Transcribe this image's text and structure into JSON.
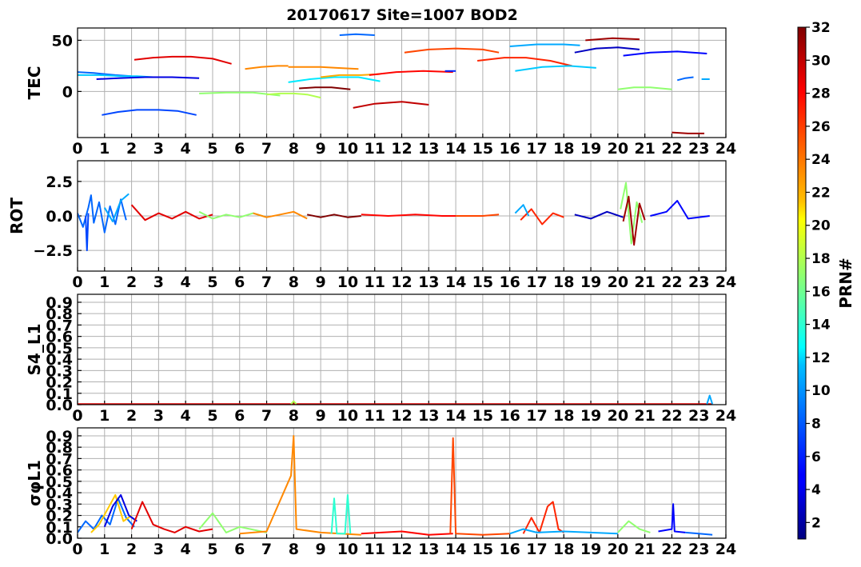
{
  "figure": {
    "title": "20170617 Site=1007 BOD2",
    "x_ticks": [
      "0",
      "1",
      "2",
      "3",
      "4",
      "5",
      "6",
      "7",
      "8",
      "9",
      "10",
      "11",
      "12",
      "13",
      "14",
      "15",
      "16",
      "17",
      "18",
      "19",
      "20",
      "21",
      "22",
      "23",
      "24"
    ]
  },
  "colorbar": {
    "label": "PRN#",
    "range": [
      1,
      32
    ],
    "ticks": [
      "2",
      "4",
      "6",
      "8",
      "10",
      "12",
      "14",
      "16",
      "18",
      "20",
      "22",
      "24",
      "26",
      "28",
      "30",
      "32"
    ],
    "colormap": "jet"
  },
  "chart_data": [
    {
      "type": "line",
      "ylabel": "TEC",
      "xlim": [
        0,
        24
      ],
      "ylim": [
        -45,
        62
      ],
      "y_ticks": [
        "0",
        "50"
      ],
      "grid": true,
      "series": [
        {
          "prn": 8,
          "x": [
            0,
            0.6,
            1.0,
            1.4,
            2.0
          ],
          "y": [
            19,
            18,
            17,
            16,
            15
          ]
        },
        {
          "prn": 11,
          "x": [
            0,
            0.8,
            1.6,
            2.2,
            2.8
          ],
          "y": [
            16,
            16,
            15,
            15,
            14
          ]
        },
        {
          "prn": 4,
          "x": [
            0.7,
            1.5,
            2.5,
            3.5,
            4.5
          ],
          "y": [
            12,
            13,
            14,
            14,
            13
          ]
        },
        {
          "prn": 7,
          "x": [
            0.9,
            1.5,
            2.2,
            3.0,
            3.7,
            4.4
          ],
          "y": [
            -23,
            -20,
            -18,
            -18,
            -19,
            -23
          ]
        },
        {
          "prn": 29,
          "x": [
            2.1,
            2.8,
            3.5,
            4.2,
            5.0,
            5.7
          ],
          "y": [
            31,
            33,
            34,
            34,
            32,
            27
          ]
        },
        {
          "prn": 17,
          "x": [
            4.5,
            5.5,
            6.5,
            7.5
          ],
          "y": [
            -2,
            -1,
            -1,
            -4
          ]
        },
        {
          "prn": 24,
          "x": [
            6.2,
            6.8,
            7.4,
            7.8
          ],
          "y": [
            22,
            24,
            25,
            25
          ]
        },
        {
          "prn": 18,
          "x": [
            7.0,
            7.5,
            8.0,
            8.5,
            9.0
          ],
          "y": [
            -3,
            -2,
            -2,
            -3,
            -6
          ]
        },
        {
          "prn": 24,
          "x": [
            7.8,
            8.4,
            9.0,
            9.6,
            10.4
          ],
          "y": [
            24,
            24,
            24,
            23,
            22
          ]
        },
        {
          "prn": 12,
          "x": [
            7.8,
            8.6,
            9.5,
            10.4,
            11.2
          ],
          "y": [
            9,
            12,
            14,
            14,
            10
          ]
        },
        {
          "prn": 32,
          "x": [
            8.2,
            8.8,
            9.4,
            10.1
          ],
          "y": [
            3,
            4,
            4,
            2
          ]
        },
        {
          "prn": 23,
          "x": [
            9.0,
            9.7,
            10.5,
            11.2
          ],
          "y": [
            14,
            16,
            16,
            17
          ]
        },
        {
          "prn": 8,
          "x": [
            9.7,
            10.3,
            11.0
          ],
          "y": [
            55,
            56,
            55
          ]
        },
        {
          "prn": 30,
          "x": [
            10.2,
            11.0,
            12.0,
            13.0
          ],
          "y": [
            -16,
            -12,
            -10,
            -13
          ]
        },
        {
          "prn": 28,
          "x": [
            10.8,
            11.8,
            12.8,
            13.9
          ],
          "y": [
            16,
            19,
            20,
            19
          ]
        },
        {
          "prn": 6,
          "x": [
            13.6,
            14.0
          ],
          "y": [
            20,
            20
          ]
        },
        {
          "prn": 26,
          "x": [
            12.1,
            13.0,
            14.0,
            15.0,
            15.6
          ],
          "y": [
            38,
            41,
            42,
            41,
            38
          ]
        },
        {
          "prn": 27,
          "x": [
            14.8,
            15.8,
            16.6,
            17.5,
            18.3
          ],
          "y": [
            30,
            33,
            33,
            30,
            25
          ]
        },
        {
          "prn": 10,
          "x": [
            16.0,
            17.0,
            18.0,
            18.6
          ],
          "y": [
            44,
            46,
            46,
            45
          ]
        },
        {
          "prn": 11,
          "x": [
            16.2,
            17.2,
            18.2,
            19.2
          ],
          "y": [
            20,
            24,
            25,
            23
          ]
        },
        {
          "prn": 3,
          "x": [
            18.4,
            19.2,
            20.0,
            20.8
          ],
          "y": [
            38,
            42,
            43,
            41
          ]
        },
        {
          "prn": 31,
          "x": [
            18.8,
            19.8,
            20.8
          ],
          "y": [
            50,
            52,
            51
          ]
        },
        {
          "prn": 5,
          "x": [
            20.2,
            21.2,
            22.2,
            23.3
          ],
          "y": [
            35,
            38,
            39,
            37
          ]
        },
        {
          "prn": 17,
          "x": [
            20.0,
            20.6,
            21.2,
            22.0
          ],
          "y": [
            2,
            4,
            4,
            2
          ]
        },
        {
          "prn": 8,
          "x": [
            22.2,
            22.5,
            22.8
          ],
          "y": [
            11,
            13,
            14
          ]
        },
        {
          "prn": 10,
          "x": [
            23.1,
            23.4
          ],
          "y": [
            12,
            12
          ]
        },
        {
          "prn": 31,
          "x": [
            22.0,
            22.6,
            23.2
          ],
          "y": [
            -40,
            -41,
            -41
          ]
        }
      ]
    },
    {
      "type": "line",
      "ylabel": "ROT",
      "xlim": [
        0,
        24
      ],
      "ylim": [
        -4,
        4
      ],
      "y_ticks": [
        "-2.5",
        "0.0",
        "2.5"
      ],
      "grid": true,
      "series": [
        {
          "prn": 8,
          "x": [
            0.0,
            0.2,
            0.4,
            0.5,
            0.6,
            0.8,
            1.0,
            1.2,
            1.4,
            1.6,
            1.8
          ],
          "y": [
            0.2,
            -0.8,
            0.6,
            1.5,
            -0.5,
            1.0,
            -1.2,
            0.7,
            -0.6,
            1.2,
            -0.3
          ]
        },
        {
          "prn": 7,
          "x": [
            0.3,
            0.35,
            0.4
          ],
          "y": [
            0.0,
            -2.5,
            0.2
          ]
        },
        {
          "prn": 10,
          "x": [
            1.0,
            1.3,
            1.6,
            1.9
          ],
          "y": [
            0.6,
            -0.4,
            1.1,
            1.6
          ]
        },
        {
          "prn": 29,
          "x": [
            2.0,
            2.5,
            3.0,
            3.5,
            4.0,
            4.5,
            5.0
          ],
          "y": [
            0.8,
            -0.3,
            0.2,
            -0.2,
            0.3,
            -0.2,
            0.1
          ]
        },
        {
          "prn": 17,
          "x": [
            4.5,
            5.0,
            5.5,
            6.0,
            6.5,
            7.0
          ],
          "y": [
            0.3,
            -0.2,
            0.1,
            -0.1,
            0.2,
            -0.1
          ]
        },
        {
          "prn": 24,
          "x": [
            6.5,
            7.0,
            7.5,
            8.0,
            8.5
          ],
          "y": [
            0.2,
            -0.1,
            0.1,
            0.3,
            -0.2
          ]
        },
        {
          "prn": 32,
          "x": [
            8.5,
            9.0,
            9.5,
            10.0,
            10.5
          ],
          "y": [
            0.1,
            -0.1,
            0.1,
            -0.1,
            0.0
          ]
        },
        {
          "prn": 28,
          "x": [
            10.5,
            11.5,
            12.5,
            13.5,
            14.0
          ],
          "y": [
            0.1,
            0.0,
            0.1,
            0.0,
            0.0
          ]
        },
        {
          "prn": 26,
          "x": [
            14.0,
            15.0,
            15.6
          ],
          "y": [
            0.0,
            0.0,
            0.1
          ]
        },
        {
          "prn": 27,
          "x": [
            16.4,
            16.8,
            17.2,
            17.6,
            18.0
          ],
          "y": [
            -0.3,
            0.5,
            -0.6,
            0.2,
            -0.1
          ]
        },
        {
          "prn": 10,
          "x": [
            16.2,
            16.5,
            16.7
          ],
          "y": [
            0.2,
            0.8,
            0.0
          ]
        },
        {
          "prn": 3,
          "x": [
            18.4,
            19.0,
            19.6,
            20.2
          ],
          "y": [
            0.1,
            -0.2,
            0.3,
            -0.1
          ]
        },
        {
          "prn": 17,
          "x": [
            20.1,
            20.3,
            20.5,
            20.7,
            20.9
          ],
          "y": [
            0.5,
            2.4,
            -2.0,
            1.0,
            -0.5
          ]
        },
        {
          "prn": 31,
          "x": [
            20.2,
            20.4,
            20.6,
            20.8,
            21.0
          ],
          "y": [
            -0.4,
            1.4,
            -2.1,
            0.9,
            -0.3
          ]
        },
        {
          "prn": 5,
          "x": [
            21.2,
            21.8,
            22.2,
            22.6,
            23.4
          ],
          "y": [
            0.0,
            0.3,
            1.1,
            -0.2,
            0.0
          ]
        }
      ]
    },
    {
      "type": "line",
      "ylabel": "S4_L1",
      "xlim": [
        0,
        24
      ],
      "ylim": [
        0,
        0.97
      ],
      "y_ticks": [
        "0.0",
        "0.1",
        "0.2",
        "0.3",
        "0.4",
        "0.5",
        "0.6",
        "0.7",
        "0.8",
        "0.9"
      ],
      "grid": true,
      "series": [
        {
          "prn": 29,
          "x": [
            0,
            6,
            12,
            18,
            23.5
          ],
          "y": [
            0.005,
            0.005,
            0.005,
            0.005,
            0.005
          ]
        },
        {
          "prn": 18,
          "x": [
            7.9,
            8.0,
            8.1
          ],
          "y": [
            0.005,
            0.03,
            0.005
          ]
        },
        {
          "prn": 10,
          "x": [
            23.3,
            23.4,
            23.5
          ],
          "y": [
            0.005,
            0.08,
            0.005
          ]
        }
      ]
    },
    {
      "type": "line",
      "ylabel": "σφL1",
      "xlim": [
        0,
        24
      ],
      "ylim": [
        0,
        0.97
      ],
      "y_ticks": [
        "0.0",
        "0.1",
        "0.2",
        "0.3",
        "0.4",
        "0.5",
        "0.6",
        "0.7",
        "0.8",
        "0.9"
      ],
      "grid": true,
      "series": [
        {
          "prn": 8,
          "x": [
            0.0,
            0.3,
            0.6,
            0.9,
            1.2,
            1.5,
            1.8,
            2.1
          ],
          "y": [
            0.05,
            0.15,
            0.08,
            0.2,
            0.12,
            0.35,
            0.18,
            0.1
          ]
        },
        {
          "prn": 22,
          "x": [
            0.5,
            0.8,
            1.1,
            1.4,
            1.7,
            2.0
          ],
          "y": [
            0.05,
            0.12,
            0.25,
            0.38,
            0.15,
            0.2
          ]
        },
        {
          "prn": 4,
          "x": [
            1.0,
            1.3,
            1.6,
            1.9,
            2.2
          ],
          "y": [
            0.1,
            0.28,
            0.38,
            0.2,
            0.15
          ]
        },
        {
          "prn": 29,
          "x": [
            2.0,
            2.4,
            2.8,
            3.2,
            3.6,
            4.0,
            4.5,
            5.0
          ],
          "y": [
            0.08,
            0.32,
            0.12,
            0.08,
            0.05,
            0.1,
            0.06,
            0.08
          ]
        },
        {
          "prn": 17,
          "x": [
            4.5,
            5.0,
            5.5,
            6.0,
            7.0
          ],
          "y": [
            0.08,
            0.22,
            0.05,
            0.1,
            0.05
          ]
        },
        {
          "prn": 24,
          "x": [
            6.0,
            7.0,
            7.9,
            8.0,
            8.1,
            9.0,
            10.5
          ],
          "y": [
            0.04,
            0.06,
            0.55,
            0.9,
            0.08,
            0.05,
            0.03
          ]
        },
        {
          "prn": 14,
          "x": [
            9.4,
            9.5,
            9.6,
            9.9,
            10.0,
            10.1
          ],
          "y": [
            0.04,
            0.35,
            0.04,
            0.04,
            0.38,
            0.04
          ]
        },
        {
          "prn": 28,
          "x": [
            10.5,
            12.0,
            13.0,
            13.9
          ],
          "y": [
            0.04,
            0.06,
            0.03,
            0.04
          ]
        },
        {
          "prn": 26,
          "x": [
            13.8,
            13.9,
            14.0,
            15.0,
            16.0
          ],
          "y": [
            0.04,
            0.88,
            0.04,
            0.03,
            0.04
          ]
        },
        {
          "prn": 27,
          "x": [
            16.5,
            16.8,
            17.1,
            17.4,
            17.6,
            17.8,
            18.0
          ],
          "y": [
            0.04,
            0.18,
            0.05,
            0.28,
            0.32,
            0.08,
            0.05
          ]
        },
        {
          "prn": 10,
          "x": [
            16.0,
            16.5,
            17.0,
            18.0,
            19.0,
            20.0
          ],
          "y": [
            0.04,
            0.08,
            0.05,
            0.06,
            0.05,
            0.04
          ]
        },
        {
          "prn": 17,
          "x": [
            20.0,
            20.4,
            20.8,
            21.2
          ],
          "y": [
            0.05,
            0.15,
            0.08,
            0.05
          ]
        },
        {
          "prn": 5,
          "x": [
            21.5,
            22.0,
            22.05,
            22.1,
            22.5
          ],
          "y": [
            0.06,
            0.08,
            0.3,
            0.06,
            0.05
          ]
        },
        {
          "prn": 8,
          "x": [
            22.5,
            23.0,
            23.5
          ],
          "y": [
            0.05,
            0.04,
            0.03
          ]
        }
      ]
    }
  ]
}
